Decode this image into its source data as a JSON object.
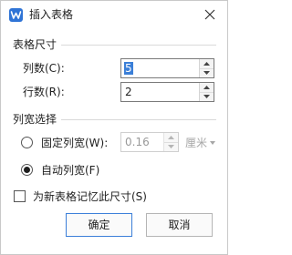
{
  "dialog": {
    "title": "插入表格",
    "accent_color": "#2f74d6"
  },
  "table_size": {
    "section_label": "表格尺寸",
    "columns_label": "列数(C):",
    "columns_value": "5",
    "rows_label": "行数(R):",
    "rows_value": "2"
  },
  "column_width": {
    "section_label": "列宽选择",
    "fixed_label": "固定列宽(W):",
    "fixed_value": "0.16",
    "unit": "厘米",
    "auto_label": "自动列宽(F)",
    "selected": "auto"
  },
  "remember": {
    "label": "为新表格记忆此尺寸(S)",
    "checked": false
  },
  "buttons": {
    "ok": "确定",
    "cancel": "取消"
  }
}
